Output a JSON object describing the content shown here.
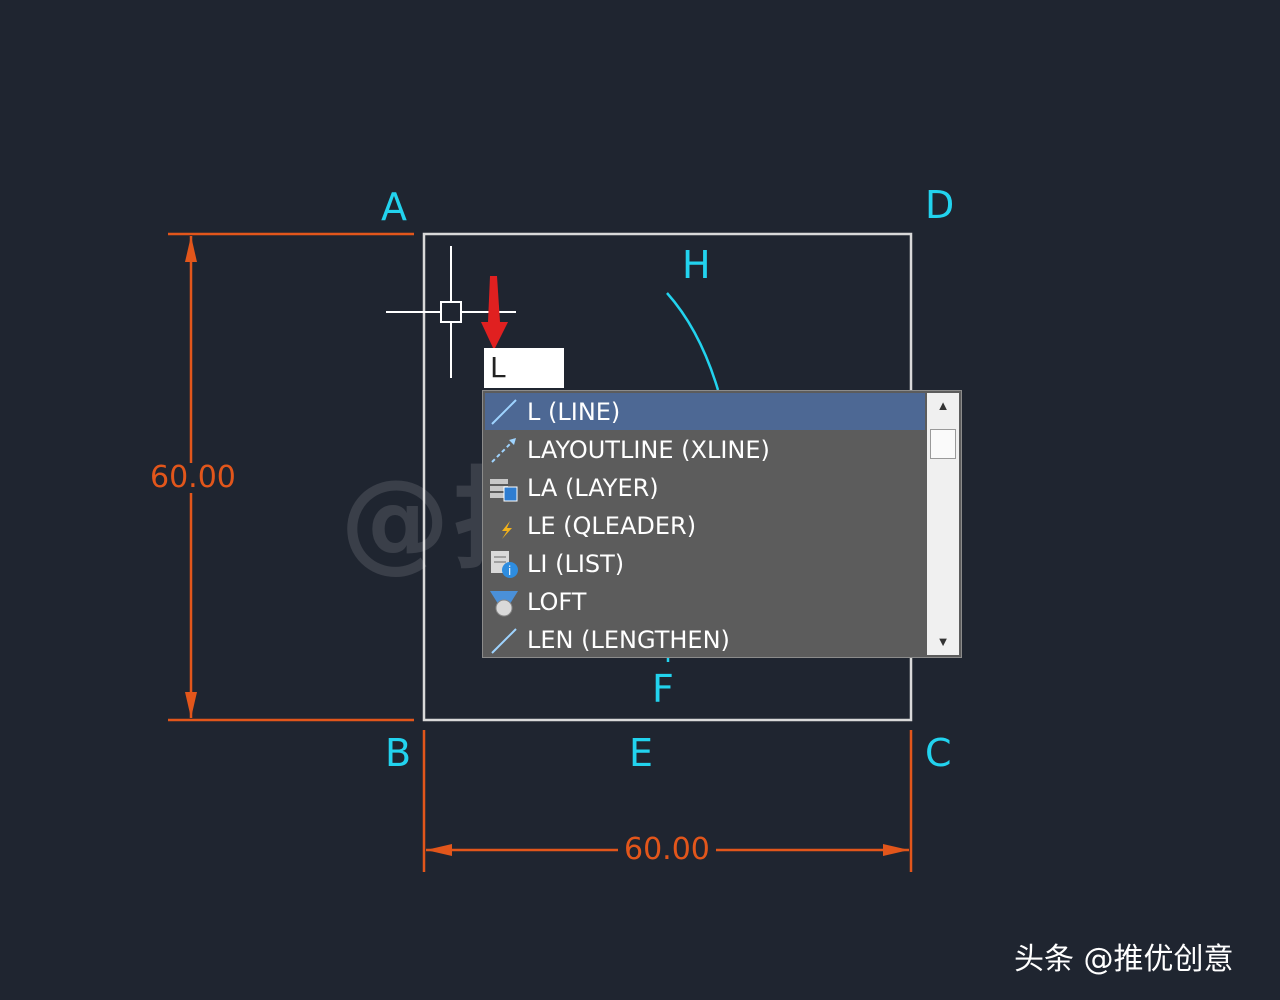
{
  "drawing": {
    "points": {
      "A": "A",
      "B": "B",
      "C": "C",
      "D": "D",
      "E": "E",
      "F": "F",
      "H": "H"
    },
    "dim_vertical": "60.00",
    "dim_horizontal": "60.00"
  },
  "command_input": {
    "value": "L"
  },
  "autocomplete": {
    "items": [
      {
        "label": "L (LINE)",
        "icon": "line-icon",
        "selected": true
      },
      {
        "label": "LAYOUTLINE (XLINE)",
        "icon": "xline-icon",
        "selected": false
      },
      {
        "label": "LA (LAYER)",
        "icon": "layer-icon",
        "selected": false
      },
      {
        "label": "LE (QLEADER)",
        "icon": "qleader-icon",
        "selected": false
      },
      {
        "label": "LI (LIST)",
        "icon": "list-icon",
        "selected": false
      },
      {
        "label": "LOFT",
        "icon": "loft-icon",
        "selected": false
      },
      {
        "label": "LEN (LENGTHEN)",
        "icon": "lengthen-icon",
        "selected": false
      }
    ]
  },
  "watermark": {
    "text": "@推优创意"
  },
  "credit": {
    "text": "头条 @推优创意"
  },
  "colors": {
    "background": "#1f2530",
    "geometry": "#d9d9d9",
    "label": "#22d3ee",
    "dimension": "#e2561b",
    "arrow": "#e02020",
    "selection": "#4d6894"
  }
}
